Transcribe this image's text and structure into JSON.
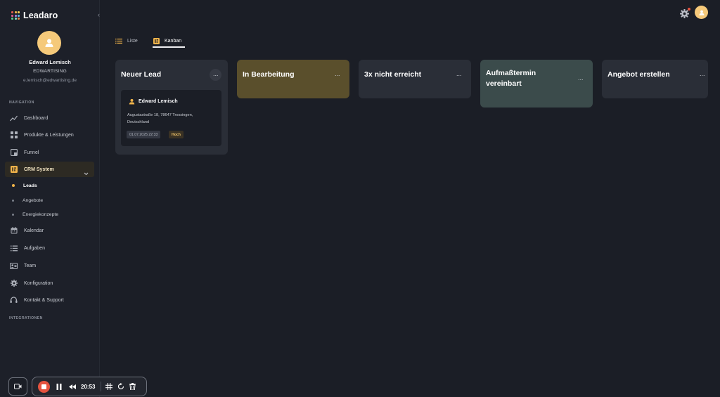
{
  "app": {
    "name": "Leadaro"
  },
  "user": {
    "name": "Edward Lemisch",
    "company": "EDWARTISING",
    "email": "e.lemisch@edwartising.de"
  },
  "sidebar": {
    "navigation_label": "NAVIGATION",
    "integrations_label": "INTEGRATIONEN",
    "items": [
      {
        "label": "Dashboard",
        "icon": "trend-icon"
      },
      {
        "label": "Produkte & Leistungen",
        "icon": "grid-icon"
      },
      {
        "label": "Funnel",
        "icon": "funnel-icon"
      },
      {
        "label": "CRM System",
        "icon": "crm-icon",
        "expanded": true
      },
      {
        "label": "Kalendar",
        "icon": "calendar-icon"
      },
      {
        "label": "Aufgaben",
        "icon": "list-icon"
      },
      {
        "label": "Team",
        "icon": "team-icon"
      },
      {
        "label": "Konfiguration",
        "icon": "gear-icon"
      },
      {
        "label": "Kontakt & Support",
        "icon": "support-icon"
      }
    ],
    "crm_subitems": [
      {
        "label": "Leads",
        "active": true
      },
      {
        "label": "Angebote",
        "active": false
      },
      {
        "label": "Energiekonzepte",
        "active": false
      }
    ]
  },
  "tabs": [
    {
      "label": "Liste",
      "active": false
    },
    {
      "label": "Kanban",
      "active": true
    }
  ],
  "kanban": {
    "columns": [
      {
        "title": "Neuer Lead",
        "color": "#2a2e37"
      },
      {
        "title": "In Bearbeitung",
        "color": "#5a4f2c"
      },
      {
        "title": "3x nicht erreicht",
        "color": "#2a2e37"
      },
      {
        "title": "Aufmaßtermin vereinbart",
        "color": "#3b4b4b"
      },
      {
        "title": "Angebot erstellen",
        "color": "#2a2e37"
      }
    ],
    "cards": [
      {
        "name": "Edward Lemisch",
        "address": "Augustastraße 18, 78647 Trossingen, Deutschland",
        "date": "01.07.2025 22:33",
        "priority": "Hoch"
      }
    ]
  },
  "recorder": {
    "time": "20:53"
  },
  "colors": {
    "accent": "#f0b34a",
    "record": "#e5533f",
    "background": "#1b1e26"
  }
}
